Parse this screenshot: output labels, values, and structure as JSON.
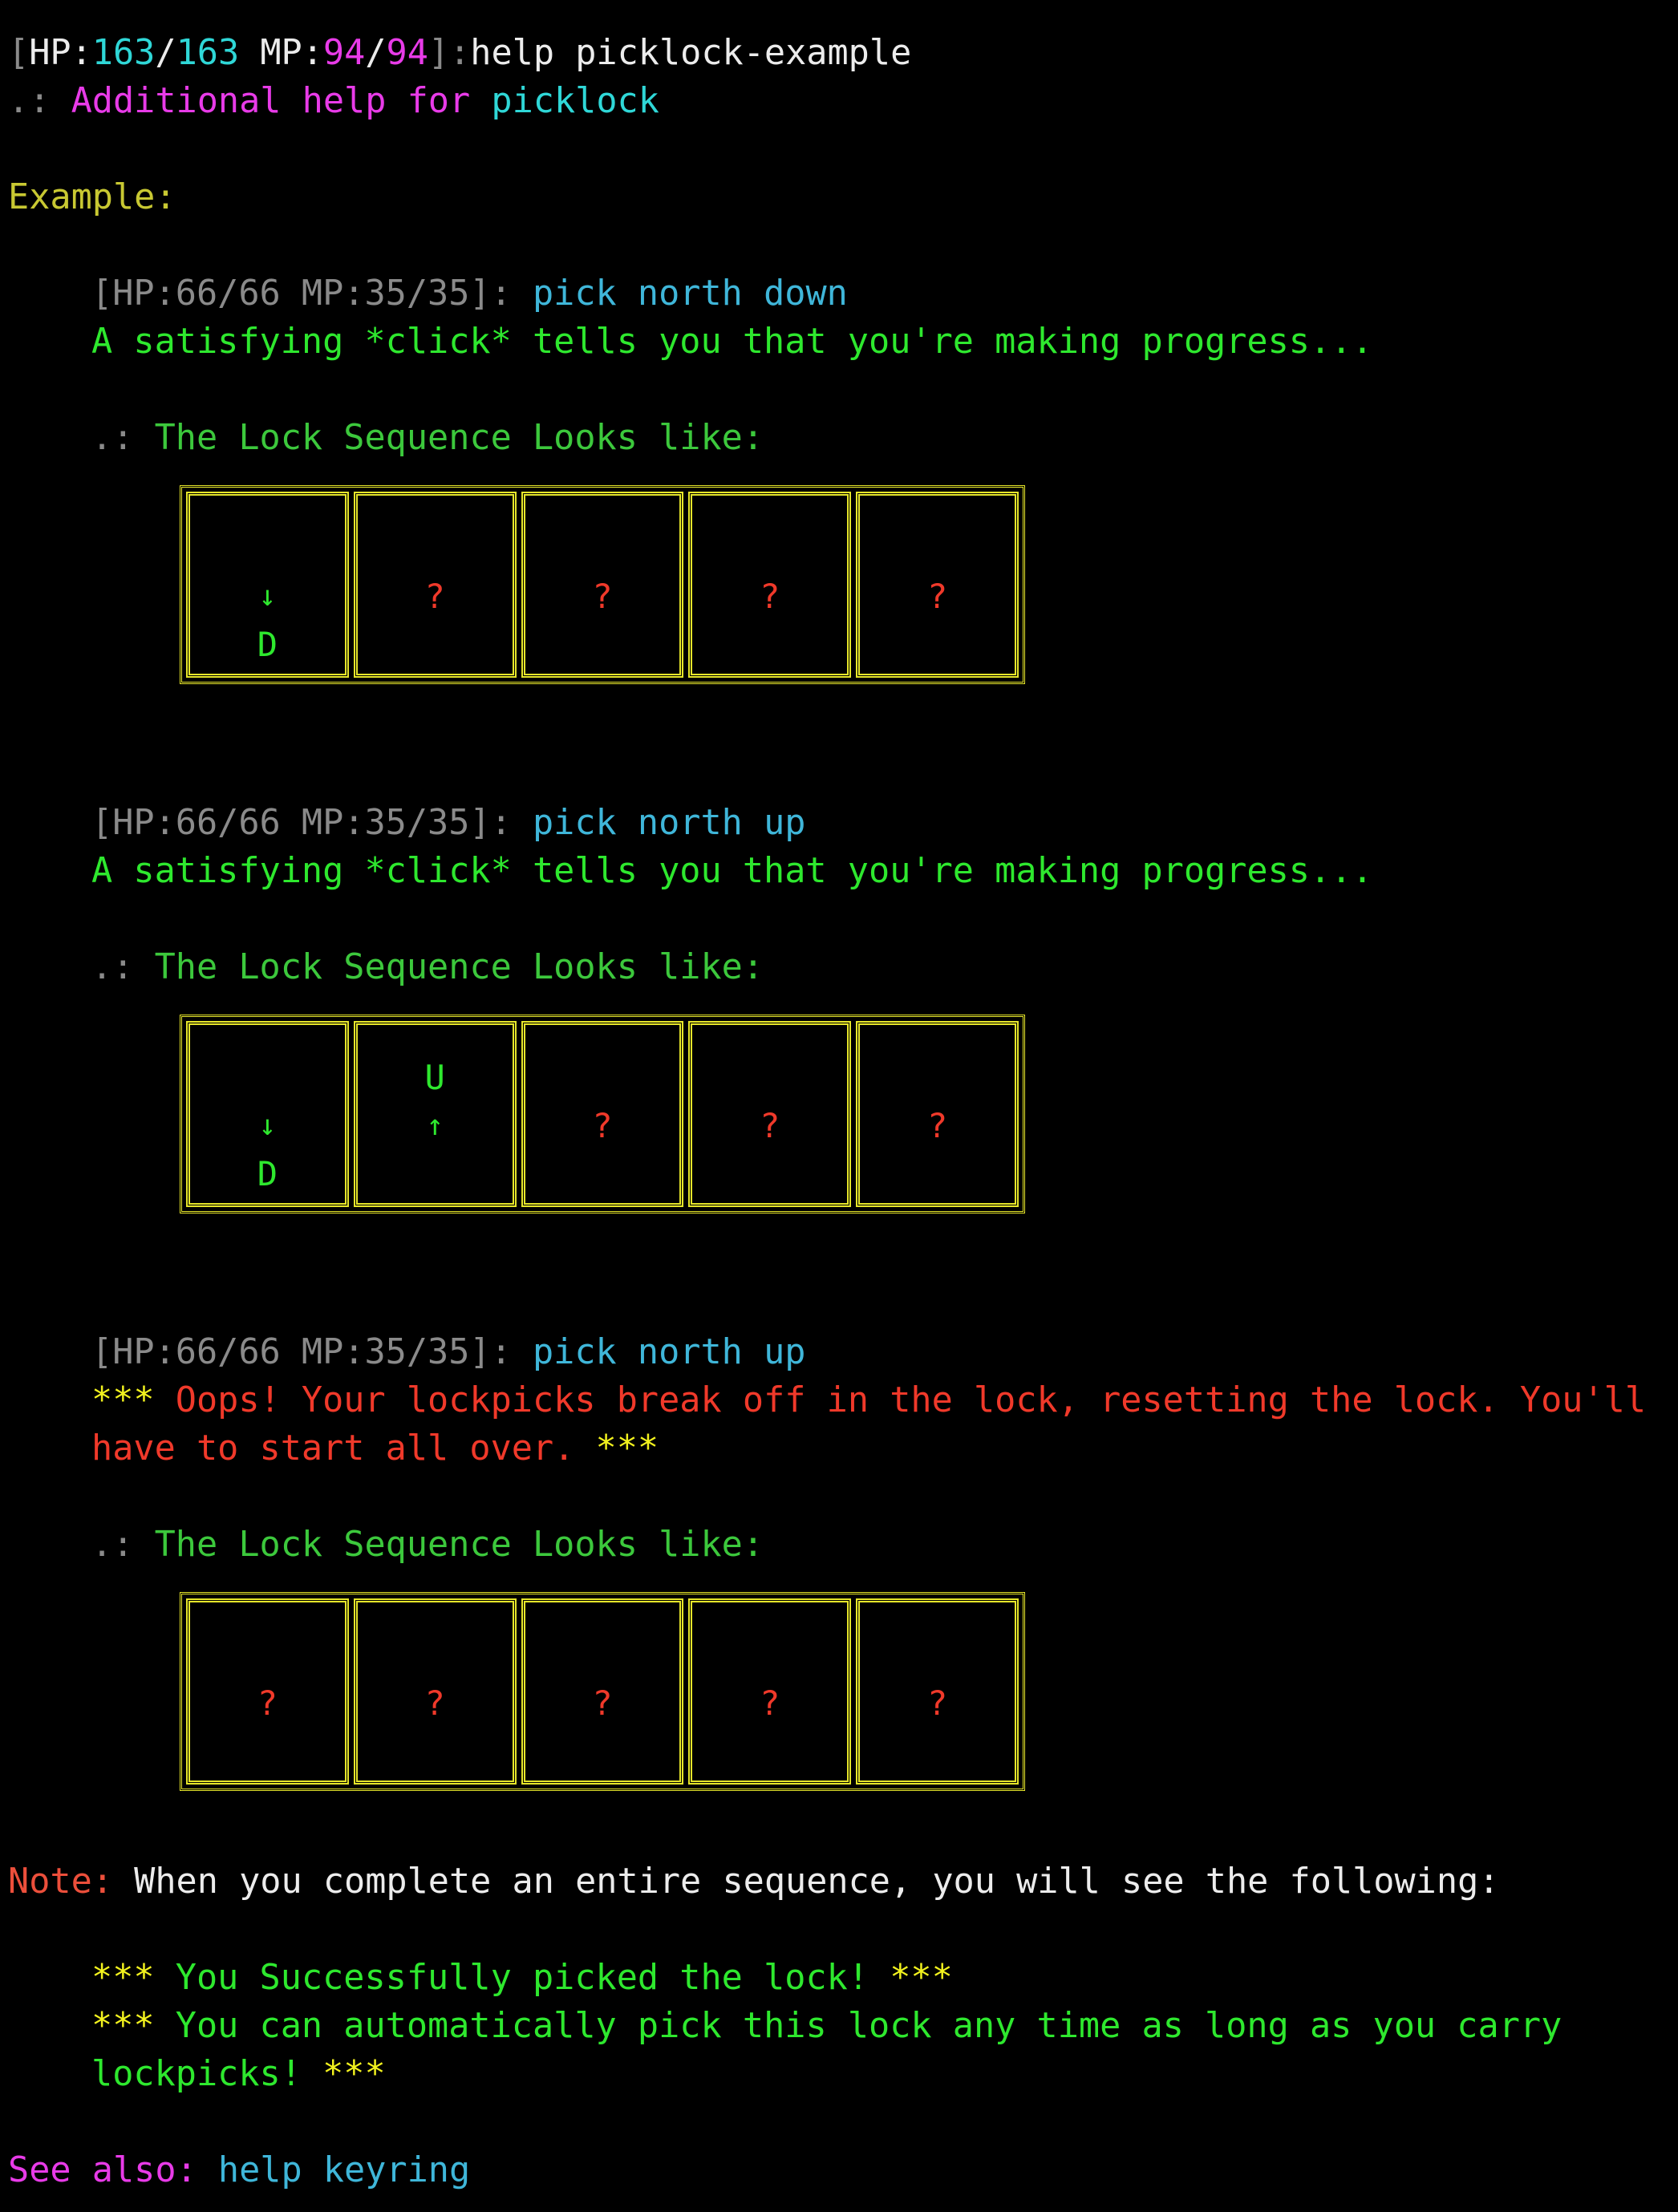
{
  "prompt_line": {
    "bracket_open": "[",
    "hp_label": "HP:",
    "hp_cur": "163",
    "hp_sep": "/",
    "hp_max": "163",
    "mp_label": " MP:",
    "mp_cur": "94",
    "mp_sep": "/",
    "mp_max": "94",
    "bracket_close": "]:",
    "command": "help picklock-example"
  },
  "header": {
    "prefix": ".: ",
    "title": "Additional help for ",
    "topic": "picklock"
  },
  "example_label": "Example:",
  "attempts": [
    {
      "prompt": "[HP:66/66 MP:35/35]: ",
      "command": "pick north down",
      "message": "A satisfying *click* tells you that you're making progress...",
      "sequence_prefix": ".: ",
      "sequence_label": "The Lock Sequence Looks like:",
      "cells": [
        {
          "top": "",
          "mid": "↓",
          "bot": "D",
          "state": "down"
        },
        {
          "top": "",
          "mid": "?",
          "bot": "",
          "state": "unknown"
        },
        {
          "top": "",
          "mid": "?",
          "bot": "",
          "state": "unknown"
        },
        {
          "top": "",
          "mid": "?",
          "bot": "",
          "state": "unknown"
        },
        {
          "top": "",
          "mid": "?",
          "bot": "",
          "state": "unknown"
        }
      ]
    },
    {
      "prompt": "[HP:66/66 MP:35/35]: ",
      "command": "pick north up",
      "message": "A satisfying *click* tells you that you're making progress...",
      "sequence_prefix": ".: ",
      "sequence_label": "The Lock Sequence Looks like:",
      "cells": [
        {
          "top": "",
          "mid": "↓",
          "bot": "D",
          "state": "down"
        },
        {
          "top": "U",
          "mid": "↑",
          "bot": "",
          "state": "up"
        },
        {
          "top": "",
          "mid": "?",
          "bot": "",
          "state": "unknown"
        },
        {
          "top": "",
          "mid": "?",
          "bot": "",
          "state": "unknown"
        },
        {
          "top": "",
          "mid": "?",
          "bot": "",
          "state": "unknown"
        }
      ]
    },
    {
      "prompt": "[HP:66/66 MP:35/35]: ",
      "command": "pick north up",
      "fail_stars_open": "***",
      "fail_line1": " Oops! Your lockpicks break off in the lock, resetting the lock. You'll",
      "fail_line2": "have to start all over. ",
      "fail_stars_close": "***",
      "sequence_prefix": ".: ",
      "sequence_label": "The Lock Sequence Looks like:",
      "cells": [
        {
          "top": "",
          "mid": "?",
          "bot": "",
          "state": "unknown"
        },
        {
          "top": "",
          "mid": "?",
          "bot": "",
          "state": "unknown"
        },
        {
          "top": "",
          "mid": "?",
          "bot": "",
          "state": "unknown"
        },
        {
          "top": "",
          "mid": "?",
          "bot": "",
          "state": "unknown"
        },
        {
          "top": "",
          "mid": "?",
          "bot": "",
          "state": "unknown"
        }
      ]
    }
  ],
  "note": {
    "label": "Note:",
    "text": " When you complete an entire sequence, you will see the following:"
  },
  "success": {
    "stars": "***",
    "line1": " You Successfully picked the lock! ",
    "line2": " You can automatically pick this lock any time as long as you carry",
    "line3": "lockpicks! "
  },
  "see_also": {
    "label": "See also:",
    "link": " help keyring"
  },
  "colors": {
    "background": "#000000",
    "hp_mp_values_cyan": "#2fd7d7",
    "mp_magenta": "#e83be8",
    "command_blue": "#3fb6d9",
    "message_green": "#2ee82e",
    "box_yellow": "#e6e62a",
    "unknown_red": "#f0392a",
    "example_olive": "#c8c832"
  }
}
